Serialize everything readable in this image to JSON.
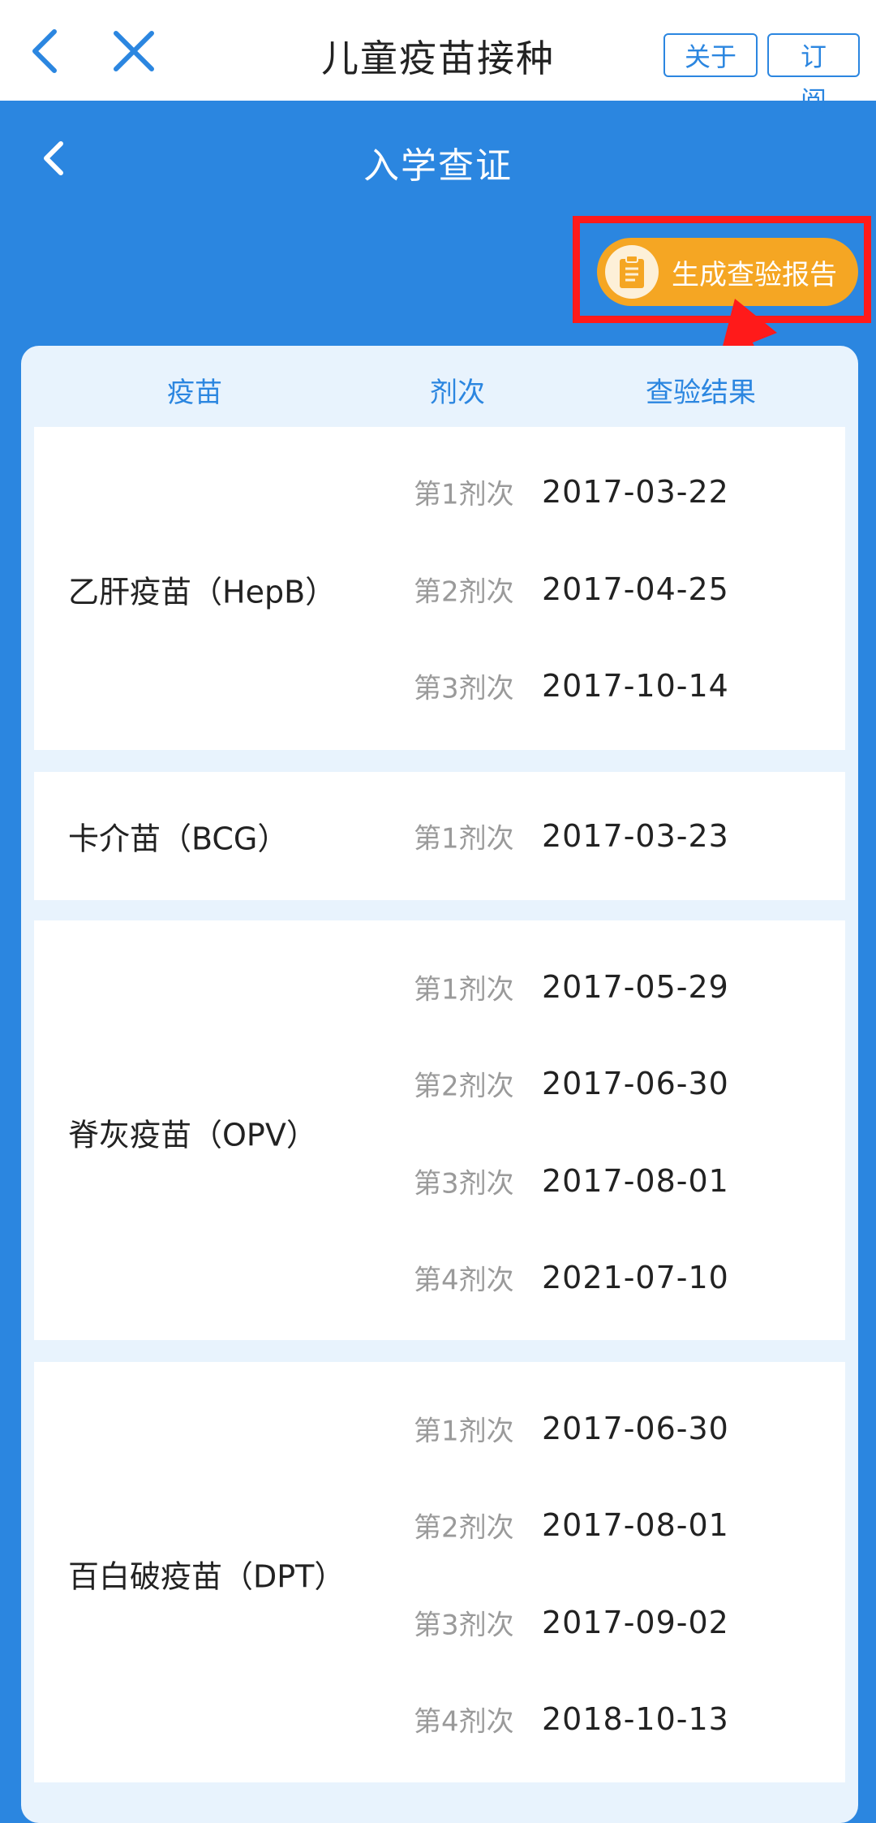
{
  "topbar": {
    "title": "儿童疫苗接种",
    "about_label": "关于",
    "subscribe_label": "订阅"
  },
  "page": {
    "title": "入学查证",
    "report_button_label": "生成查验报告"
  },
  "table": {
    "headers": [
      "疫苗",
      "剂次",
      "查验结果"
    ],
    "groups": [
      {
        "name": "乙肝疫苗（HepB）",
        "doses": [
          {
            "dose": "第1剂次",
            "date": "2017-03-22"
          },
          {
            "dose": "第2剂次",
            "date": "2017-04-25"
          },
          {
            "dose": "第3剂次",
            "date": "2017-10-14"
          }
        ]
      },
      {
        "name": "卡介苗（BCG）",
        "doses": [
          {
            "dose": "第1剂次",
            "date": "2017-03-23"
          }
        ]
      },
      {
        "name": "脊灰疫苗（OPV）",
        "doses": [
          {
            "dose": "第1剂次",
            "date": "2017-05-29"
          },
          {
            "dose": "第2剂次",
            "date": "2017-06-30"
          },
          {
            "dose": "第3剂次",
            "date": "2017-08-01"
          },
          {
            "dose": "第4剂次",
            "date": "2021-07-10"
          }
        ]
      },
      {
        "name": "百白破疫苗（DPT）",
        "doses": [
          {
            "dose": "第1剂次",
            "date": "2017-06-30"
          },
          {
            "dose": "第2剂次",
            "date": "2017-08-01"
          },
          {
            "dose": "第3剂次",
            "date": "2017-09-02"
          },
          {
            "dose": "第4剂次",
            "date": "2018-10-13"
          }
        ]
      }
    ]
  },
  "colors": {
    "primary_blue": "#2b86e0",
    "report_orange": "#f5a623",
    "highlight_red": "#ff1a1a"
  },
  "icons": {
    "back": "chevron-left-icon",
    "close": "close-icon",
    "report": "clipboard-icon"
  }
}
